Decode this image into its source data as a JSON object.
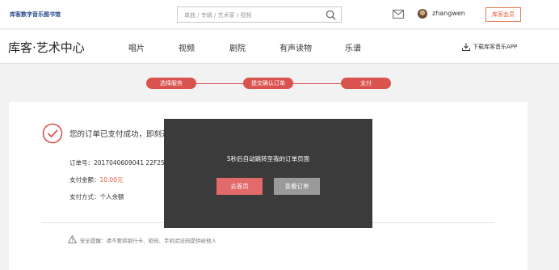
{
  "header": {
    "brand": "库客数字音乐图书馆",
    "search_placeholder": "单曲 / 专辑 / 艺术家 / 视频",
    "username": "zhangwen",
    "vip_label": "库客会员"
  },
  "nav": {
    "logo": "库客·艺术中心",
    "items": [
      "唱片",
      "视频",
      "剧院",
      "有声读物",
      "乐谱"
    ],
    "download": "下载库客音乐APP"
  },
  "steps": [
    "选择服务",
    "提交确认订单",
    "支付"
  ],
  "order": {
    "success": "您的订单已支付成功，即刻开始音乐之旅",
    "order_no_label": "订单号：",
    "order_no": "2017040609041 22F259C201",
    "amount_label": "支付金额：",
    "amount": "10.00元",
    "method_label": "支付方式：",
    "method": "个人余额"
  },
  "warning": "安全提醒：请不要将银行卡、密码、手机验证码提供给他人",
  "modal": {
    "message": "5秒后自动跳转至我的订单页面",
    "home_button": "去首页",
    "view_button": "查看订单"
  },
  "colors": {
    "accent": "#d9534f",
    "amount": "#e0593a",
    "modal_bg": "#3b3b3b"
  }
}
